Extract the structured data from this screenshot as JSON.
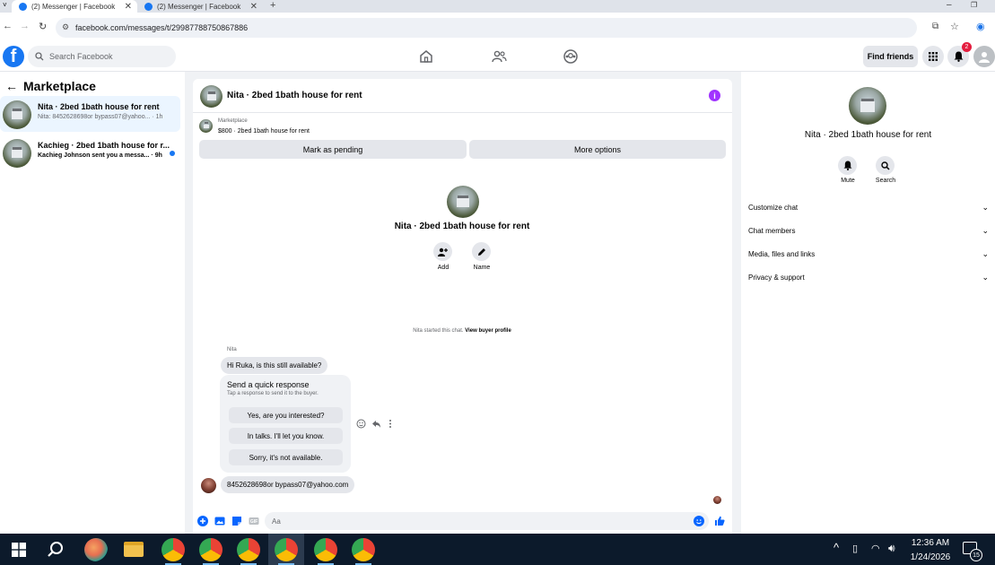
{
  "browser": {
    "tabs": [
      {
        "title": "(2) Messenger | Facebook",
        "active": true
      },
      {
        "title": "(2) Messenger | Facebook",
        "active": false
      }
    ],
    "url": "facebook.com/messages/t/29987788750867886"
  },
  "fb_header": {
    "logo": "f",
    "search_placeholder": "Search Facebook",
    "find_friends_label": "Find friends",
    "notification_count": "2"
  },
  "sidebar": {
    "title": "Marketplace",
    "conversations": [
      {
        "name": "Nita · 2bed 1bath house for rent",
        "preview": "Nita: 8452628698or bypass07@yahoo... · 1h",
        "selected": true
      },
      {
        "name": "Kachieg · 2bed 1bath house for r...",
        "preview": "Kachieg Johnson sent you a messa... · 9h",
        "selected": false,
        "unread": true
      }
    ]
  },
  "chat": {
    "title": "Nita · 2bed 1bath house for rent",
    "info_glyph": "i",
    "listing_label": "Marketplace",
    "listing_price": "$800 · 2bed 1bath house for rent",
    "mark_pending_label": "Mark as pending",
    "more_options_label": "More options",
    "center_name": "Nita · 2bed 1bath house for rent",
    "add_label": "Add",
    "name_label": "Name",
    "started_text": "Nita started this chat.",
    "view_profile_label": "View buyer profile",
    "sender_name": "Nita",
    "first_message": "Hi Ruka, is this still available?",
    "quick_title": "Send a quick response",
    "quick_subtitle": "Tap a response to send it to the buyer.",
    "quick_responses": [
      "Yes, are you interested?",
      "In talks. I'll let you know.",
      "Sorry, it's not available."
    ],
    "second_message": "8452628698or bypass07@yahoo.com",
    "composer_placeholder": "Aa"
  },
  "right_panel": {
    "name": "Nita · 2bed 1bath house for rent",
    "mute_label": "Mute",
    "search_label": "Search",
    "sections": [
      "Customize chat",
      "Chat members",
      "Media, files and links",
      "Privacy & support"
    ]
  },
  "taskbar": {
    "time": "12:36 AM",
    "date": "1/24/2026",
    "notif_count": "15"
  },
  "colors": {
    "fb_blue": "#1877f2",
    "selected_bg": "#ebf5ff",
    "taskbar": "#0c1a2b"
  }
}
